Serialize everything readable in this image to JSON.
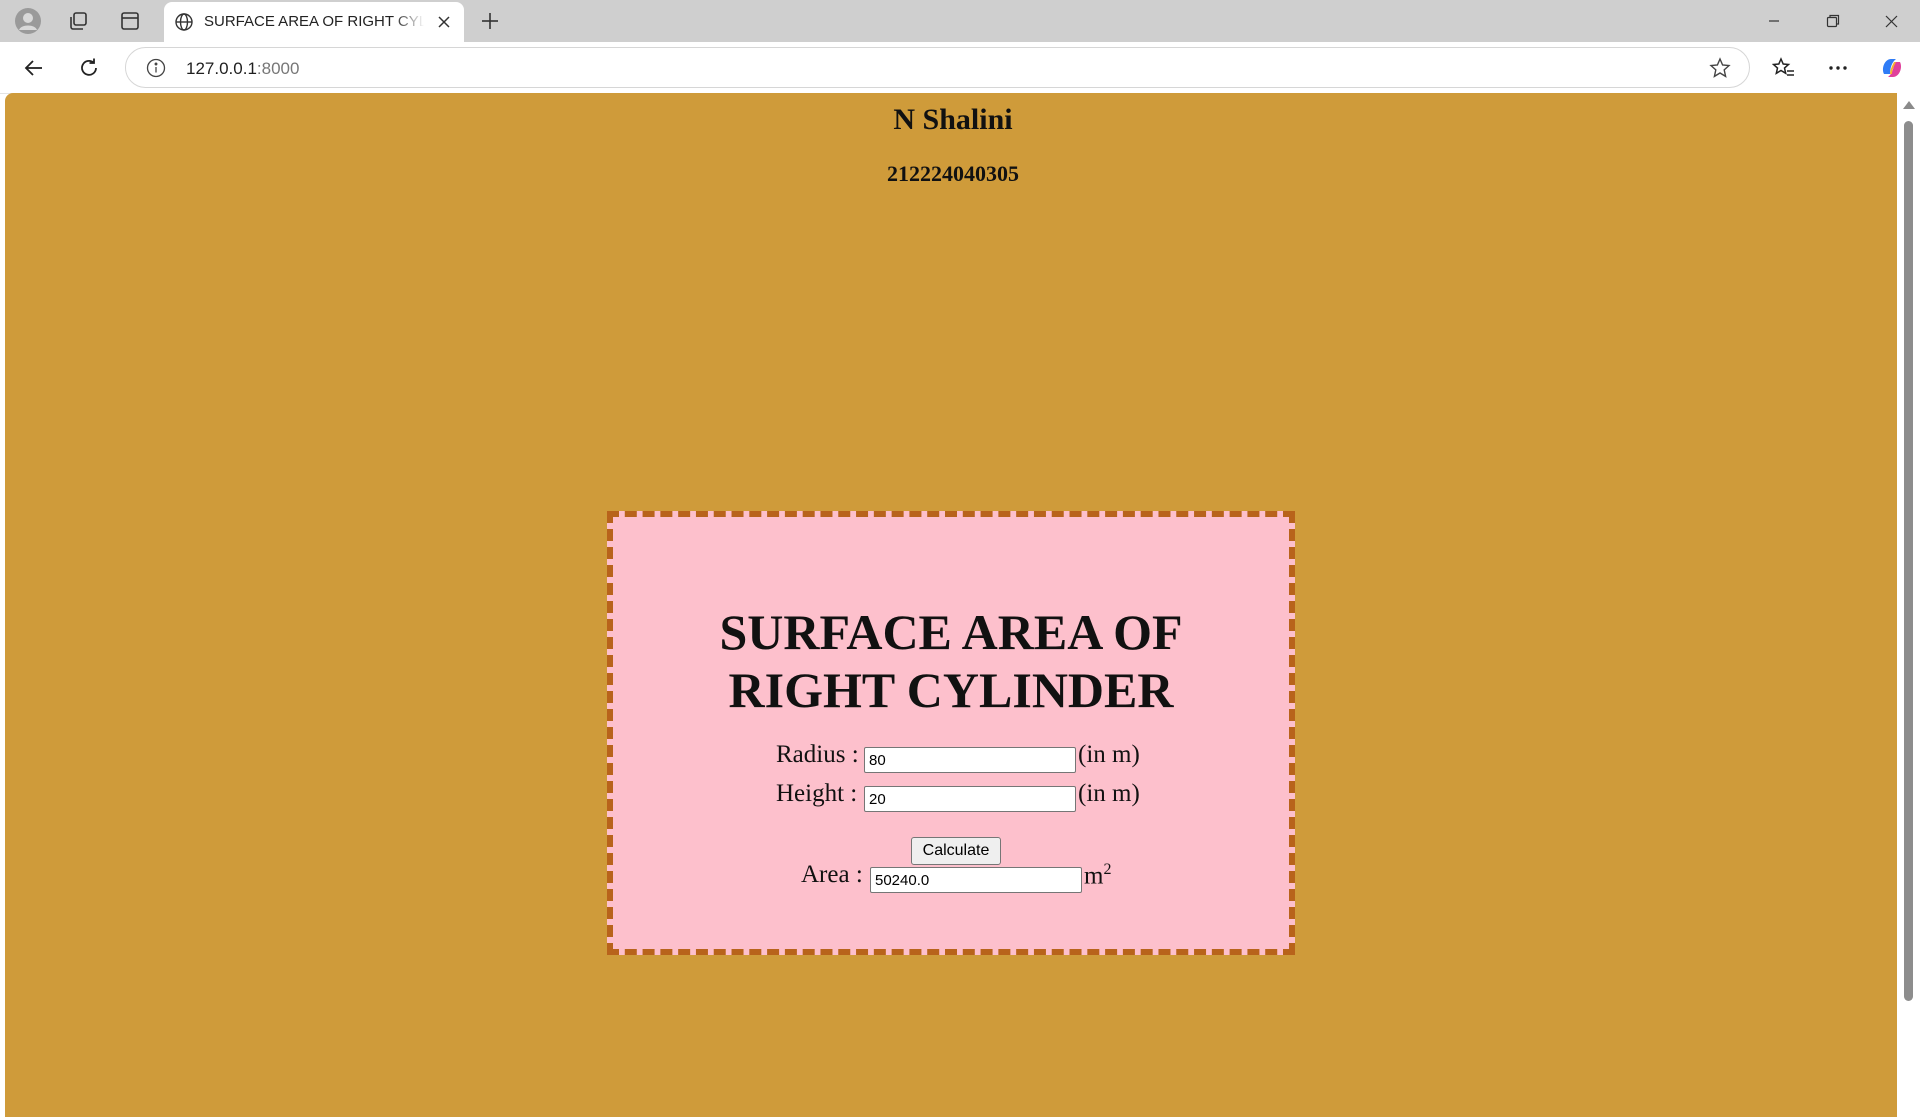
{
  "browser": {
    "tab_title": "SURFACE AREA OF RIGHT CYLINDER",
    "url_host": "127.0.0.1",
    "url_port": ":8000"
  },
  "page": {
    "author_name": "N Shalini",
    "author_id": "212224040305",
    "title_line1": "SURFACE AREA OF",
    "title_line2": "RIGHT CYLINDER",
    "radius_label": "Radius :",
    "radius_value": "80",
    "radius_unit": "(in m)",
    "height_label": "Height :",
    "height_value": "20",
    "height_unit": "(in m)",
    "calculate_label": "Calculate",
    "area_label": "Area :",
    "area_value": "50240.0",
    "area_unit": "m",
    "area_unit_exp": "2"
  },
  "colors": {
    "page_background": "#cf9b3a",
    "card_background": "#fdc0cc",
    "card_border": "#b8631b"
  }
}
